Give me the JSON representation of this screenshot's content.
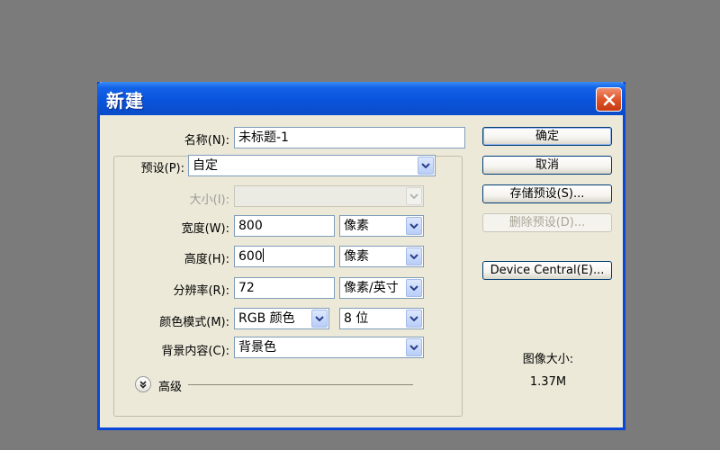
{
  "dialog": {
    "title": "新建",
    "name_label": "名称(N):",
    "name_value": "未标题-1",
    "preset_label": "预设(P):",
    "preset_value": "自定",
    "size_label": "大小(I):",
    "size_value": "",
    "width_label": "宽度(W):",
    "width_value": "800",
    "width_unit": "像素",
    "height_label": "高度(H):",
    "height_value": "600",
    "height_unit": "像素",
    "resolution_label": "分辨率(R):",
    "resolution_value": "72",
    "resolution_unit": "像素/英寸",
    "color_mode_label": "颜色模式(M):",
    "color_mode_value": "RGB 颜色",
    "bit_depth_value": "8 位",
    "background_label": "背景内容(C):",
    "background_value": "背景色",
    "advanced_label": "高级"
  },
  "buttons": {
    "ok": "确定",
    "cancel": "取消",
    "save_preset": "存储预设(S)...",
    "delete_preset": "删除预设(D)...",
    "device_central": "Device Central(E)..."
  },
  "image_size": {
    "label": "图像大小:",
    "value": "1.37M"
  },
  "colors": {
    "backdrop": "#7b7b7b",
    "dialog_bg": "#ece9d8",
    "titlebar": "#0a54dc",
    "close_button": "#e0542a"
  },
  "icons": {
    "close": "close-icon",
    "dropdown": "chevron-down-icon",
    "advanced": "double-chevron-down-icon"
  }
}
